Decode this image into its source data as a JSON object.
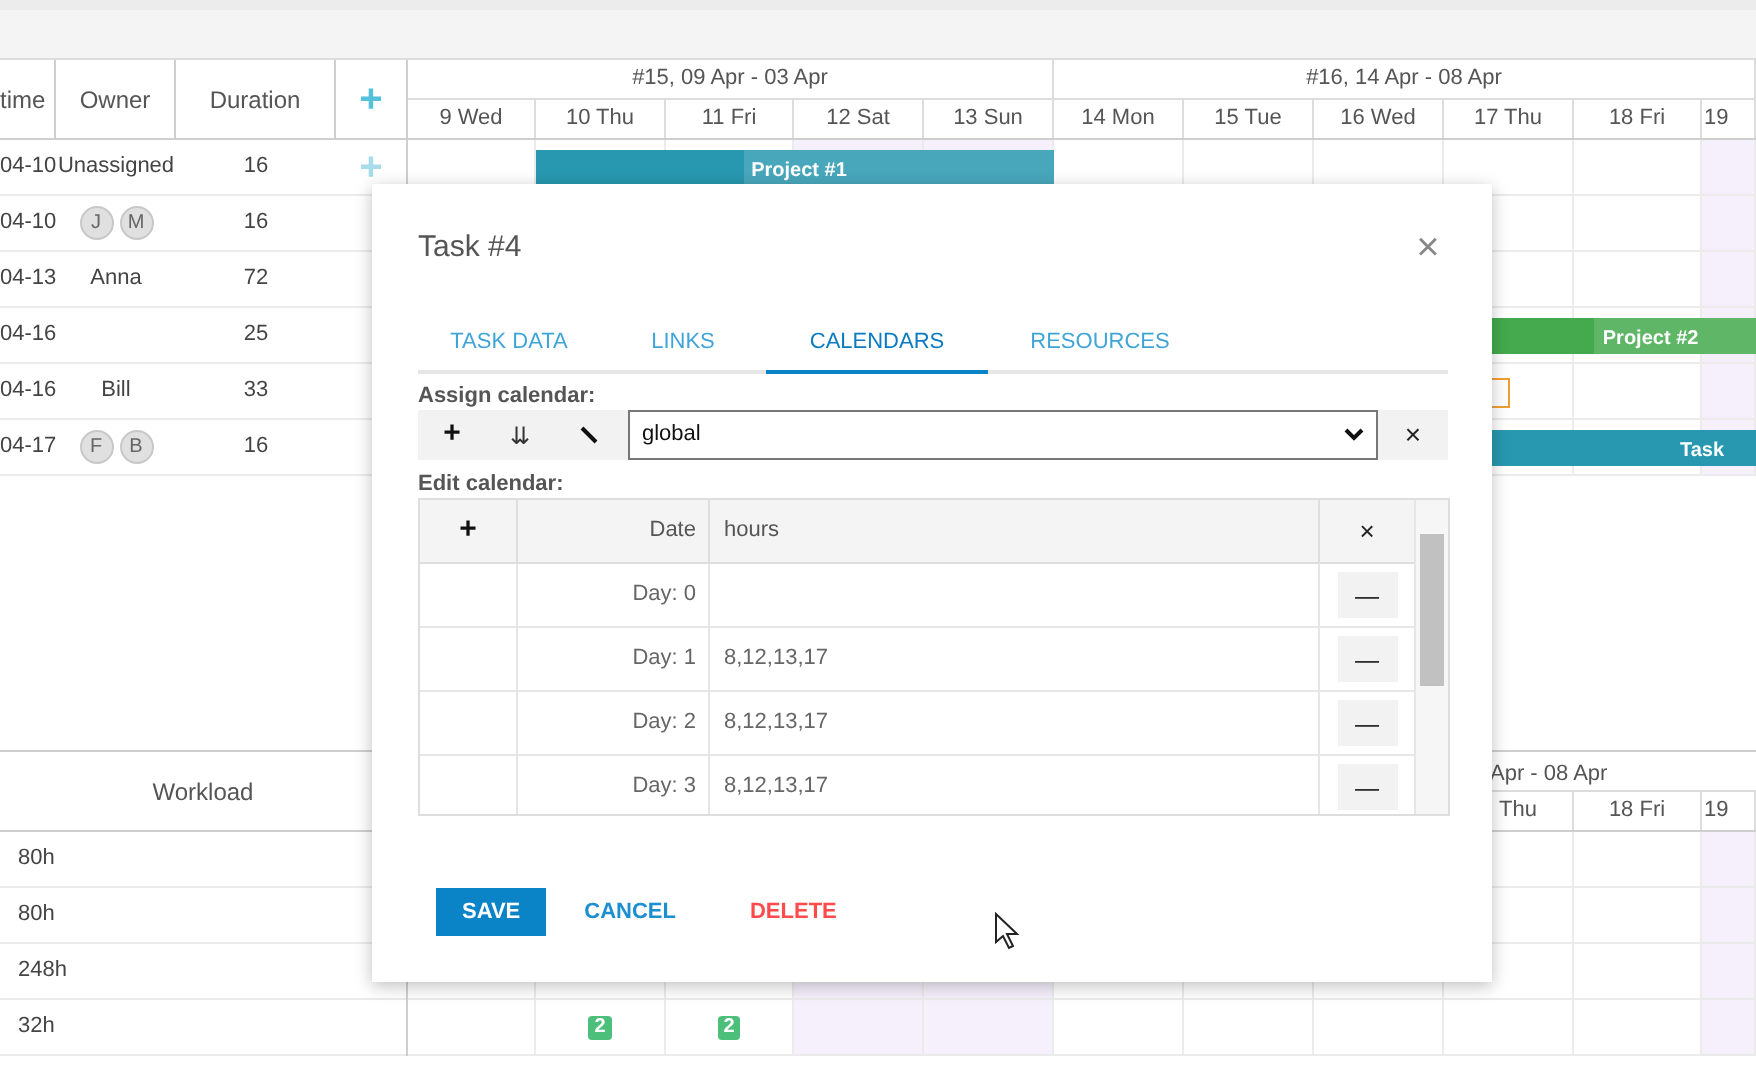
{
  "grid": {
    "columns": [
      "time",
      "Owner",
      "Duration"
    ],
    "add_icon": "+",
    "rows": [
      {
        "start": "04-10",
        "owner": "Unassigned",
        "duration": "16",
        "add": "+"
      },
      {
        "start": "04-10",
        "avatars": [
          "J",
          "M"
        ],
        "duration": "16"
      },
      {
        "start": "04-13",
        "owner": "Anna",
        "duration": "72"
      },
      {
        "start": "04-16",
        "duration": "25"
      },
      {
        "start": "04-16",
        "owner": "Bill",
        "duration": "33"
      },
      {
        "start": "04-17",
        "avatars": [
          "F",
          "B"
        ],
        "duration": "16"
      }
    ]
  },
  "timeline": {
    "weeks": [
      "#15, 09 Apr - 03 Apr",
      "#16, 14 Apr - 08 Apr"
    ],
    "days": [
      {
        "label": "9 Wed",
        "weekend": false
      },
      {
        "label": "10 Thu",
        "weekend": false
      },
      {
        "label": "11 Fri",
        "weekend": false
      },
      {
        "label": "12 Sat",
        "weekend": true
      },
      {
        "label": "13 Sun",
        "weekend": true
      },
      {
        "label": "14 Mon",
        "weekend": false
      },
      {
        "label": "15 Tue",
        "weekend": false
      },
      {
        "label": "16 Wed",
        "weekend": false
      },
      {
        "label": "17 Thu",
        "weekend": false
      },
      {
        "label": "18 Fri",
        "weekend": false
      },
      {
        "label": "19",
        "weekend": true
      }
    ],
    "bars": [
      {
        "kind": "project",
        "level": 0.4,
        "label": "Project #1",
        "color": "#2898b0"
      },
      {
        "kind": "project",
        "level": 0.54,
        "label": "Project #2",
        "color": "#44aa4d"
      },
      {
        "kind": "marker",
        "color": "#f0a030"
      },
      {
        "kind": "task",
        "label": "Task",
        "color": "#2898b0"
      }
    ]
  },
  "resources": {
    "column": "Workload",
    "rows": [
      {
        "workload": "80h"
      },
      {
        "workload": "80h"
      },
      {
        "workload": "248h"
      },
      {
        "workload": "32h",
        "badges": [
          "2",
          "2"
        ]
      }
    ],
    "week_label": "Apr - 08 Apr",
    "days": [
      "Thu",
      "18 Fri",
      "19"
    ]
  },
  "dialog": {
    "title": "Task #4",
    "close": "×",
    "tabs": [
      {
        "label": "TASK DATA",
        "selected": false
      },
      {
        "label": "LINKS",
        "selected": false
      },
      {
        "label": "CALENDARS",
        "selected": true
      },
      {
        "label": "RESOURCES",
        "selected": false
      }
    ],
    "assign_label": "Assign calendar:",
    "toolbar": [
      "+",
      "⇊"
    ],
    "calendar": "global",
    "clear": "×",
    "edit_label": "Edit calendar:",
    "table": {
      "columns": [
        "+",
        "Date",
        "hours",
        "×"
      ],
      "rows": [
        {
          "date": "Day: 0",
          "action": "—"
        },
        {
          "date": "Day: 1",
          "hours": "8,12,13,17",
          "action": "—"
        },
        {
          "date": "Day: 2",
          "hours": "8,12,13,17",
          "action": "—"
        },
        {
          "date": "Day: 3",
          "hours": "8,12,13,17",
          "action": "—"
        }
      ]
    },
    "buttons": [
      {
        "label": "SAVE",
        "kind": "primary"
      },
      {
        "label": "CANCEL",
        "kind": "secondary"
      },
      {
        "label": "DELETE",
        "kind": "danger"
      }
    ]
  }
}
